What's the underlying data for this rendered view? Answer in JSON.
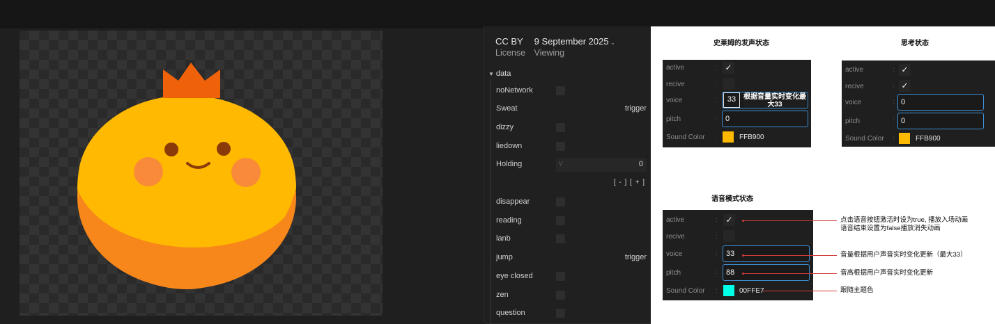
{
  "colors": {
    "accent_blue": "#3d8fd6",
    "annotation_red": "#d23b3b",
    "body_yellow": "#ffb900",
    "crown_orange": "#f0620a",
    "swatch_yellow": "#FFB900",
    "swatch_cyan": "#00FFE7"
  },
  "meta": {
    "license_value": "CC BY",
    "license_label": "License",
    "date": "9 September 2025",
    "viewing_label": "Viewing"
  },
  "panel": {
    "section": "data",
    "props": [
      {
        "label": "noNetwork",
        "kind": "bool"
      },
      {
        "label": "Sweat",
        "kind": "trigger",
        "value": "trigger"
      },
      {
        "label": "dizzy",
        "kind": "bool"
      },
      {
        "label": "liedown",
        "kind": "bool"
      },
      {
        "label": "Holding",
        "kind": "number",
        "value": "0",
        "prefix": "V"
      },
      {
        "label": "disappear",
        "kind": "bool"
      },
      {
        "label": "reading",
        "kind": "bool"
      },
      {
        "label": "lanb",
        "kind": "bool"
      },
      {
        "label": "jump",
        "kind": "trigger",
        "value": "trigger"
      },
      {
        "label": "eye closed",
        "kind": "bool"
      },
      {
        "label": "zen",
        "kind": "bool"
      },
      {
        "label": "question",
        "kind": "bool"
      }
    ],
    "stepper": "[ - ]  [ + ]"
  },
  "doc": {
    "speaking": {
      "title": "史莱姆的发声状态",
      "active": "active",
      "recive": "recive",
      "voice": "voice",
      "pitch": "pitch",
      "sound_color": "Sound Color",
      "active_check": "✓",
      "voice_value": "33",
      "voice_note": "根据音量实时变化最大33",
      "pitch_value": "0",
      "hex": "FFB900"
    },
    "thinking": {
      "title": "思考状态",
      "active": "active",
      "recive": "recive",
      "voice": "voice",
      "pitch": "pitch",
      "sound_color": "Sound Color",
      "active_check": "✓",
      "recive_check": "✓",
      "voice_value": "0",
      "pitch_value": "0",
      "hex": "FFB900"
    },
    "voice_mode": {
      "title": "语音模式状态",
      "active": "active",
      "recive": "recive",
      "voice": "voice",
      "pitch": "pitch",
      "sound_color": "Sound Color",
      "active_check": "✓",
      "voice_value": "33",
      "pitch_value": "88",
      "hex": "00FFE7",
      "note_active_1": "点击语音按钮激活时设为true, 播放入场动画",
      "note_active_2": "语音结束设置为false播放消失动画",
      "note_voice": "音量根据用户声音实时变化更新（最大33）",
      "note_pitch": "音高根据用户声音实时变化更新",
      "note_color": "跟随主题色"
    }
  }
}
